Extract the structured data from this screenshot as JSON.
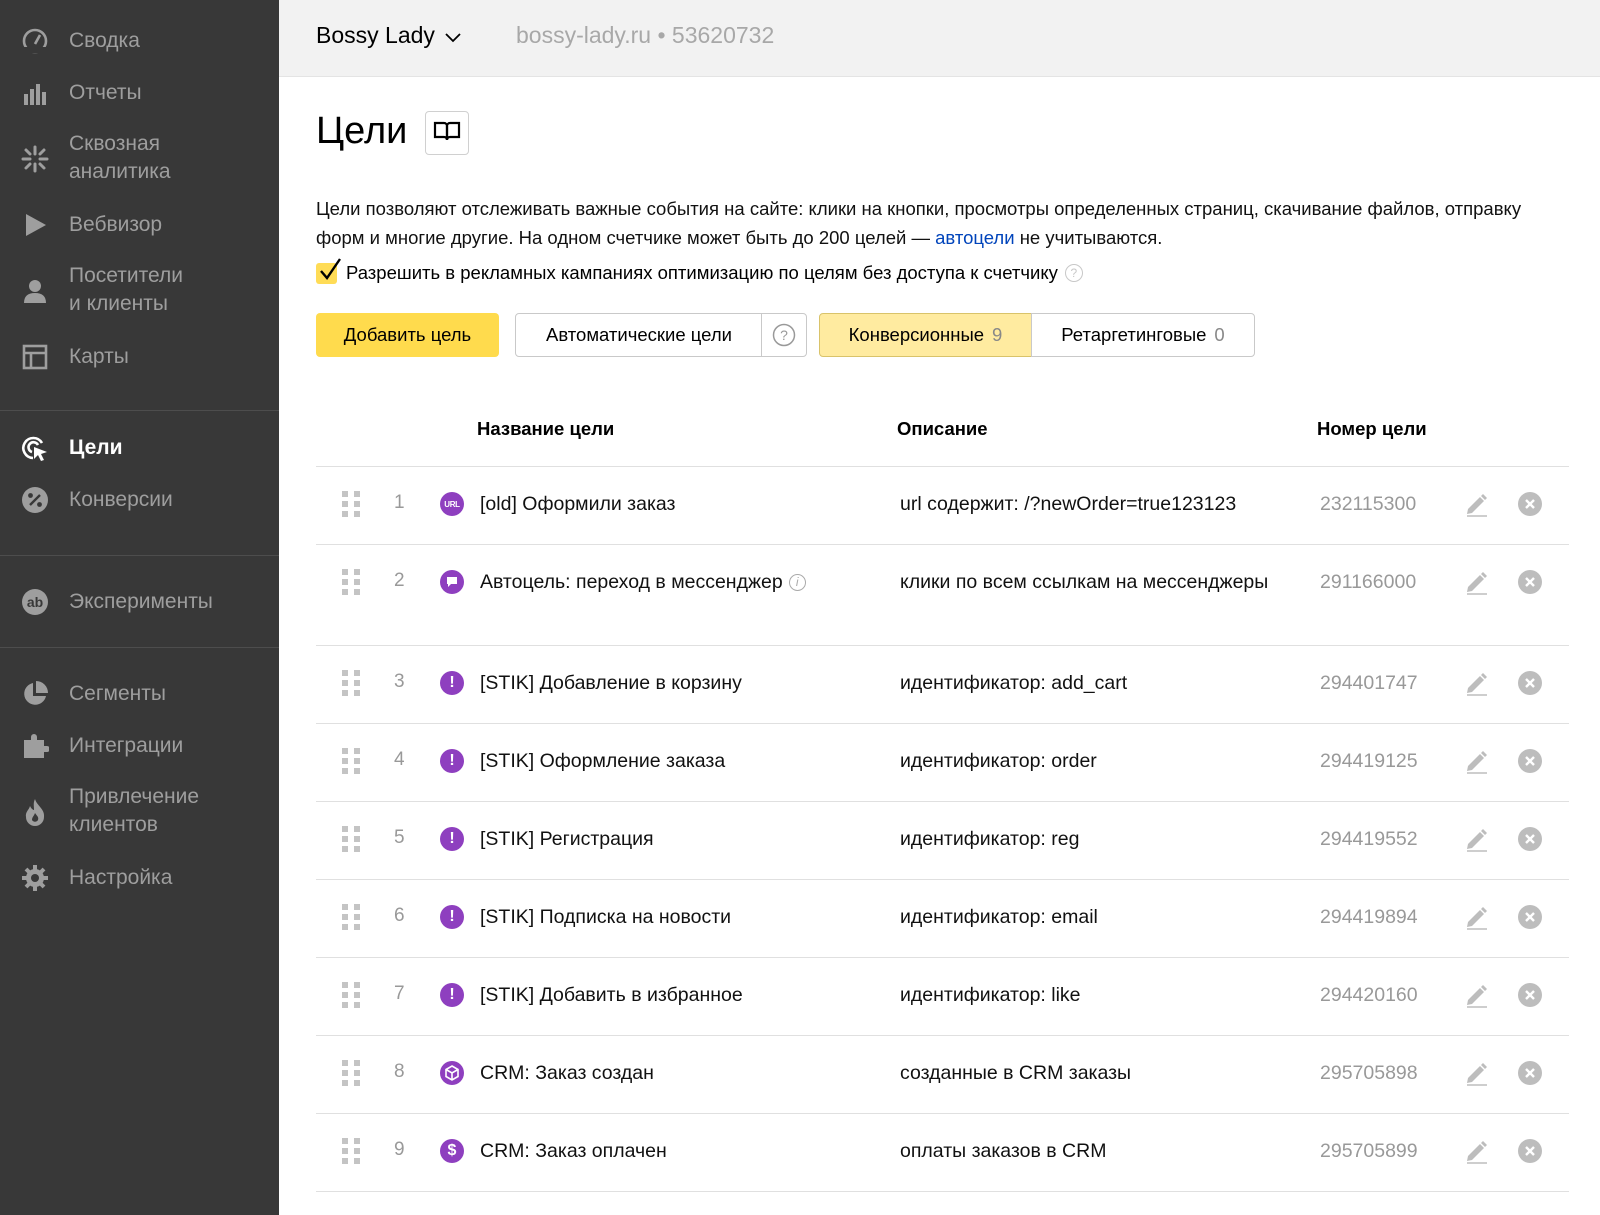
{
  "sidebar": {
    "items": [
      {
        "label": "Сводка",
        "icon": "dashboard-icon"
      },
      {
        "label": "Отчеты",
        "icon": "bar-chart-icon"
      },
      {
        "label": "Сквозная\nаналитика",
        "icon": "snowflake-icon"
      },
      {
        "label": "Вебвизор",
        "icon": "play-icon"
      },
      {
        "label": "Посетители\nи клиенты",
        "icon": "user-icon"
      },
      {
        "label": "Карты",
        "icon": "map-icon"
      },
      {
        "label": "Цели",
        "icon": "target-cursor-icon",
        "active": true
      },
      {
        "label": "Конверсии",
        "icon": "percent-icon"
      },
      {
        "label": "Эксперименты",
        "icon": "ab-icon"
      },
      {
        "label": "Сегменты",
        "icon": "pie-icon"
      },
      {
        "label": "Интеграции",
        "icon": "puzzle-icon"
      },
      {
        "label": "Привлечение\nклиентов",
        "icon": "flame-icon"
      },
      {
        "label": "Настройка",
        "icon": "gear-icon"
      }
    ]
  },
  "header": {
    "counter_name": "Bossy Lady",
    "counter_site": "bossy-lady.ru • 53620732"
  },
  "page": {
    "title": "Цели",
    "intro_before": "Цели позволяют отслеживать важные события на сайте: клики на кнопки, просмотры определенных страниц, скачивание файлов, отправку форм и многие другие. На одном счетчике может быть до 200 целей — ",
    "intro_link": "автоцели",
    "intro_after": " не учитываются.",
    "allow_label": "Разрешить в рекламных кампаниях оптимизацию по целям без доступа к счетчику",
    "allow_checked": true
  },
  "toolbar": {
    "add_label": "Добавить цель",
    "auto_label": "Автоматические цели",
    "tab_conversion_label": "Конверсионные",
    "tab_conversion_count": "9",
    "tab_retargeting_label": "Ретаргетинговые",
    "tab_retargeting_count": "0"
  },
  "table": {
    "headers": {
      "name": "Название цели",
      "description": "Описание",
      "id": "Номер цели"
    },
    "rows": [
      {
        "num": "1",
        "icon": "url-icon",
        "name": "[old] Оформили заказ",
        "description": "url содержит: /?newOrder=true123123",
        "id": "232115300"
      },
      {
        "num": "2",
        "icon": "message-icon",
        "name": "Автоцель: переход в мессенджер",
        "info": true,
        "description": "клики по всем ссылкам на мессенджеры",
        "id": "291166000"
      },
      {
        "num": "3",
        "icon": "exclamation-icon",
        "name": "[STIK] Добавление в корзину",
        "description": "идентификатор: add_cart",
        "id": "294401747"
      },
      {
        "num": "4",
        "icon": "exclamation-icon",
        "name": "[STIK] Оформление заказа",
        "description": "идентификатор: order",
        "id": "294419125"
      },
      {
        "num": "5",
        "icon": "exclamation-icon",
        "name": "[STIK] Регистрация",
        "description": "идентификатор: reg",
        "id": "294419552"
      },
      {
        "num": "6",
        "icon": "exclamation-icon",
        "name": "[STIK] Подписка на новости",
        "description": "идентификатор: email",
        "id": "294419894"
      },
      {
        "num": "7",
        "icon": "exclamation-icon",
        "name": "[STIK] Добавить в избранное",
        "description": "идентификатор: like",
        "id": "294420160"
      },
      {
        "num": "8",
        "icon": "box-icon",
        "name": "CRM: Заказ создан",
        "description": "созданные в CRM заказы",
        "id": "295705898"
      },
      {
        "num": "9",
        "icon": "dollar-icon",
        "name": "CRM: Заказ оплачен",
        "description": "оплаты заказов в CRM",
        "id": "295705899"
      }
    ]
  },
  "colors": {
    "sidebar_bg": "#383838",
    "accent_yellow": "#ffdb4d",
    "goal_icon_purple": "#8e3fbf",
    "link_blue": "#0044bb"
  }
}
